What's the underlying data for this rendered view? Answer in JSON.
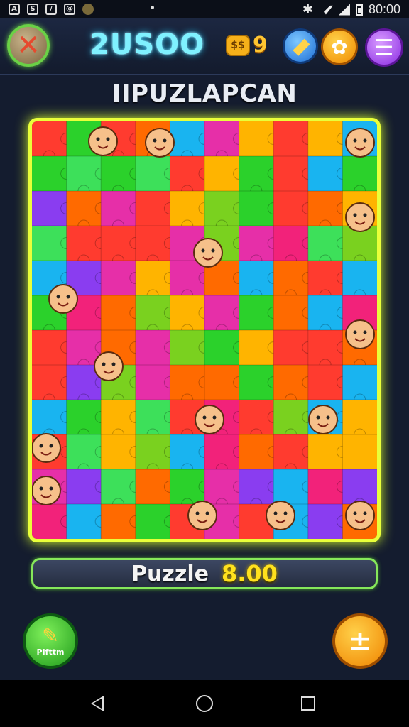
{
  "status_bar": {
    "icons": [
      "notification-a-icon",
      "notification-s-icon",
      "no-signal-icon",
      "app-icon",
      "avatar-icon"
    ],
    "time": "80:00"
  },
  "header": {
    "score": "2USOO",
    "coins": "9",
    "buttons": [
      "close-icon",
      "hint-icon",
      "shop-icon",
      "menu-icon"
    ]
  },
  "title": "IIPUZLAPCAN",
  "progress": {
    "label": "Puzzle",
    "value": "8.00"
  },
  "bottom": {
    "edit_label": "PIfttm"
  },
  "colors": {
    "accent_glow": "#e9ff3a",
    "score_cyan": "#7ff1ff",
    "gold": "#ffc531",
    "green": "#3fc21c",
    "orange": "#f08400",
    "purple": "#8a2be2"
  }
}
